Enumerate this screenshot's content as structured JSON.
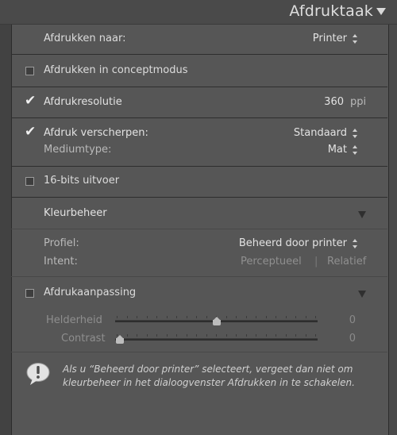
{
  "header": {
    "title": "Afdruktaak"
  },
  "print_to": {
    "label": "Afdrukken naar:",
    "value": "Printer"
  },
  "draft_mode": {
    "label": "Afdrukken in conceptmodus",
    "checked": false
  },
  "resolution": {
    "label": "Afdrukresolutie",
    "checked": true,
    "value": "360",
    "unit": "ppi"
  },
  "sharpen": {
    "label": "Afdruk verscherpen:",
    "checked": true,
    "value": "Standaard",
    "media_label": "Mediumtype:",
    "media_value": "Mat"
  },
  "bit16": {
    "label": "16-bits uitvoer",
    "checked": false
  },
  "color_mgmt": {
    "label": "Kleurbeheer",
    "profile_label": "Profiel:",
    "profile_value": "Beheerd door printer",
    "intent_label": "Intent:",
    "intent_option1": "Perceptueel",
    "intent_divider": "|",
    "intent_option2": "Relatief"
  },
  "adjust": {
    "label": "Afdrukaanpassing",
    "checked": false,
    "brightness_label": "Helderheid",
    "brightness_value": "0",
    "contrast_label": "Contrast",
    "contrast_value": "0"
  },
  "info": {
    "line1": "Als u “Beheerd door printer” selecteert, vergeet dan niet om",
    "line2": "kleurbeheer in het dialoogvenster Afdrukken in te schakelen."
  }
}
